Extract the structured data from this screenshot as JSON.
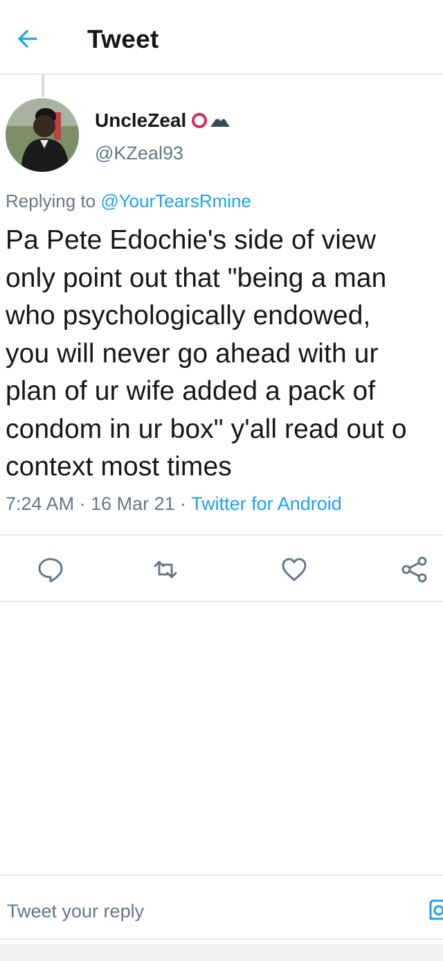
{
  "header": {
    "title": "Tweet",
    "back_icon": "arrow-left-icon"
  },
  "tweet": {
    "author_name": "UncleZeal",
    "author_handle": "@KZeal93",
    "badges": [
      "red-ring-icon",
      "mountain-icon"
    ],
    "replying_prefix": "Replying to ",
    "replying_to": "@YourTearsRmine",
    "lines": [
      "Pa Pete Edochie's side of view",
      "only point out that \"being a man",
      "who psychologically endowed,",
      "you will never go ahead with ur",
      "plan of ur wife added a pack of",
      "condom in ur box\" y'all read out o",
      "context most times"
    ],
    "time": "7:24 AM",
    "date": "16 Mar 21",
    "source": "Twitter for Android"
  },
  "actions": [
    "reply-icon",
    "retweet-icon",
    "like-icon",
    "share-icon"
  ],
  "reply_box": {
    "placeholder": "Tweet your reply",
    "icon": "camera-icon"
  },
  "colors": {
    "accent": "#1da1f2",
    "secondary_text": "#657786",
    "divider": "#e1e8ed"
  }
}
